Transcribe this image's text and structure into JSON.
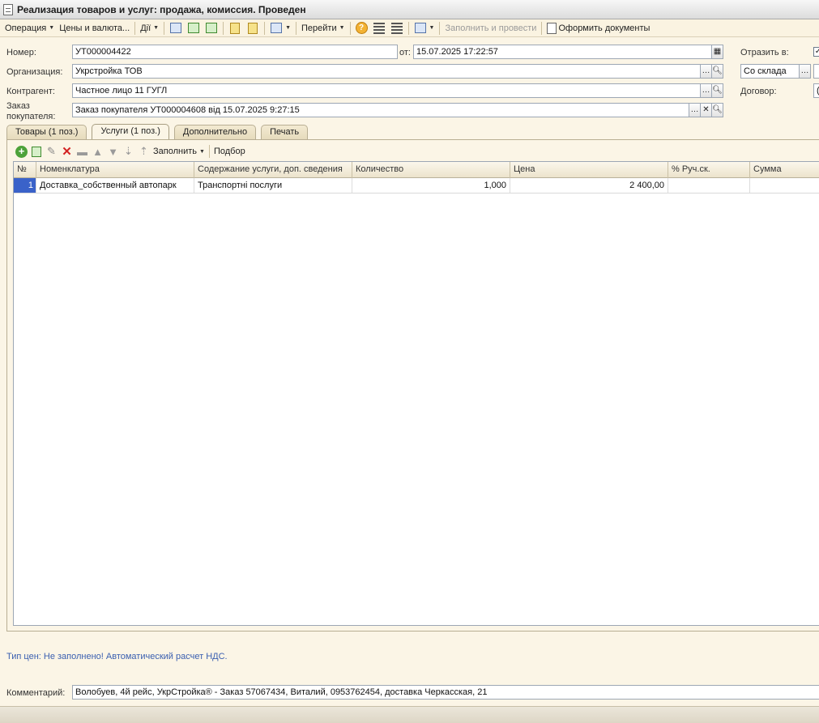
{
  "window": {
    "title": "Реализация товаров и услуг: продажа, комиссия. Проведен"
  },
  "toolbar": {
    "operation": "Операция",
    "prices": "Цены и валюта...",
    "actions": "Дії",
    "goto": "Перейти",
    "fill_post": "Заполнить и провести",
    "make_docs": "Оформить документы"
  },
  "form": {
    "number_label": "Номер:",
    "number": "УТ000004422",
    "date_label": "от:",
    "date": "15.07.2025 17:22:57",
    "org_label": "Организация:",
    "org": "Укрстройка ТОВ",
    "contractor_label": "Контрагент:",
    "contractor": "Частное лицо 11 ГУГЛ",
    "order_label_1": "Заказ",
    "order_label_2": "покупателя:",
    "order": "Заказ покупателя УТ000004608 від 15.07.2025 9:27:15",
    "reflect_label": "Отразить в:",
    "reflect_checked": true,
    "warehouse": "Со склада",
    "contract_label": "Договор:",
    "contract_value": "("
  },
  "tabs": [
    {
      "label": "Товары (1 поз.)",
      "active": false
    },
    {
      "label": "Услуги (1 поз.)",
      "active": true
    },
    {
      "label": "Дополнительно",
      "active": false
    },
    {
      "label": "Печать",
      "active": false
    }
  ],
  "tab_toolbar": {
    "fill": "Заполнить",
    "pick": "Подбор"
  },
  "table": {
    "columns": [
      "№",
      "Номенклатура",
      "Содержание услуги, доп. сведения",
      "Количество",
      "Цена",
      "% Руч.ск.",
      "Сумма"
    ],
    "rows": [
      {
        "num": "1",
        "item": "Доставка_собственный автопарк",
        "content": "Транспортні послуги",
        "qty": "1,000",
        "price": "2 400,00",
        "disc": "",
        "sum": ""
      }
    ]
  },
  "info_text": "Тип цен: Не заполнено! Автоматический расчет НДС.",
  "comment": {
    "label": "Комментарий:",
    "value": "Волобуев, 4й рейс, УкрСтройка® - Заказ 57067434, Виталий, 0953762454, доставка Черкасская, 21"
  }
}
